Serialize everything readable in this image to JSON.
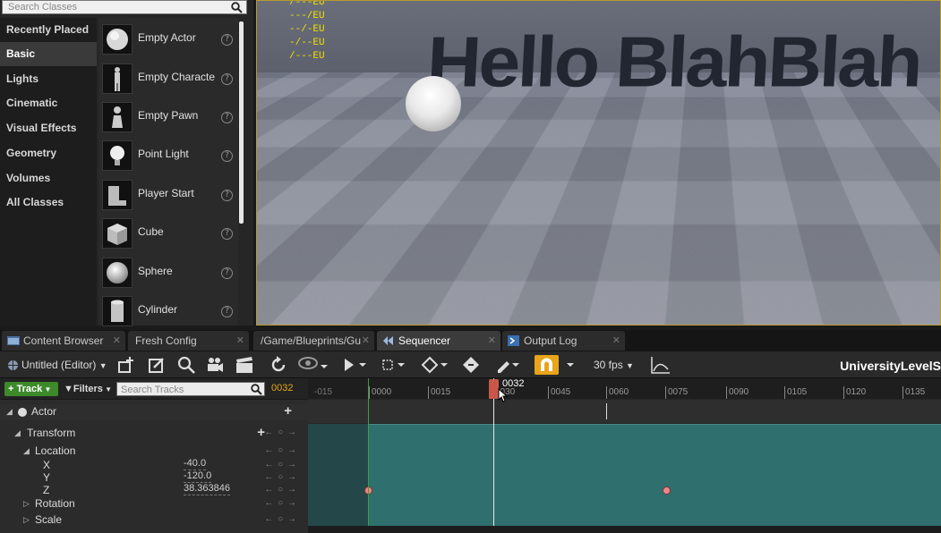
{
  "place_panel": {
    "search_placeholder": "Search Classes",
    "categories": [
      "Recently Placed",
      "Basic",
      "Lights",
      "Cinematic",
      "Visual Effects",
      "Geometry",
      "Volumes",
      "All Classes"
    ],
    "active_category": "Basic",
    "items": [
      "Empty Actor",
      "Empty Characte",
      "Empty Pawn",
      "Point Light",
      "Player Start",
      "Cube",
      "Sphere",
      "Cylinder"
    ],
    "help_glyph": "?"
  },
  "viewport": {
    "stats": [
      "/---EU",
      "---/EU",
      "--/-EU",
      "-/--EU",
      "/---EU"
    ],
    "hello_text": "Hello BlahBlah"
  },
  "tabs": [
    {
      "label": "Content Browser",
      "icon": "content-browser-icon"
    },
    {
      "label": "Fresh Config"
    },
    {
      "label": "/Game/Blueprints/Gu"
    },
    {
      "label": "Sequencer",
      "icon": "sequencer-icon"
    },
    {
      "label": "Output Log",
      "icon": "output-log-icon"
    }
  ],
  "toolbar": {
    "editor_label": "Untitled (Editor)",
    "fps_label": "30 fps",
    "level_name": "UniversityLevelS"
  },
  "tracks": {
    "add_track_label": "Track",
    "filters_label": "Filters",
    "search_placeholder": "Search Tracks",
    "current_frame": "0032",
    "rows": {
      "actor": "Actor",
      "transform": "Transform",
      "location": "Location",
      "x_label": "X",
      "x_value": "-40.0",
      "y_label": "Y",
      "y_value": "-120.0",
      "z_label": "Z",
      "z_value": "38.363846",
      "rotation": "Rotation",
      "scale": "Scale"
    },
    "key_arrows": "← ○ →"
  },
  "timeline": {
    "ticks": [
      "-015",
      "0000",
      "0015",
      "0030",
      "0045",
      "0060",
      "0075",
      "0090",
      "0105",
      "0120",
      "0135"
    ],
    "playhead_label": "0032"
  },
  "colors": {
    "accent": "#e8a41a",
    "section": "#2f6f6e",
    "stats_text": "#f0e000",
    "playhead": "#c8574a"
  }
}
